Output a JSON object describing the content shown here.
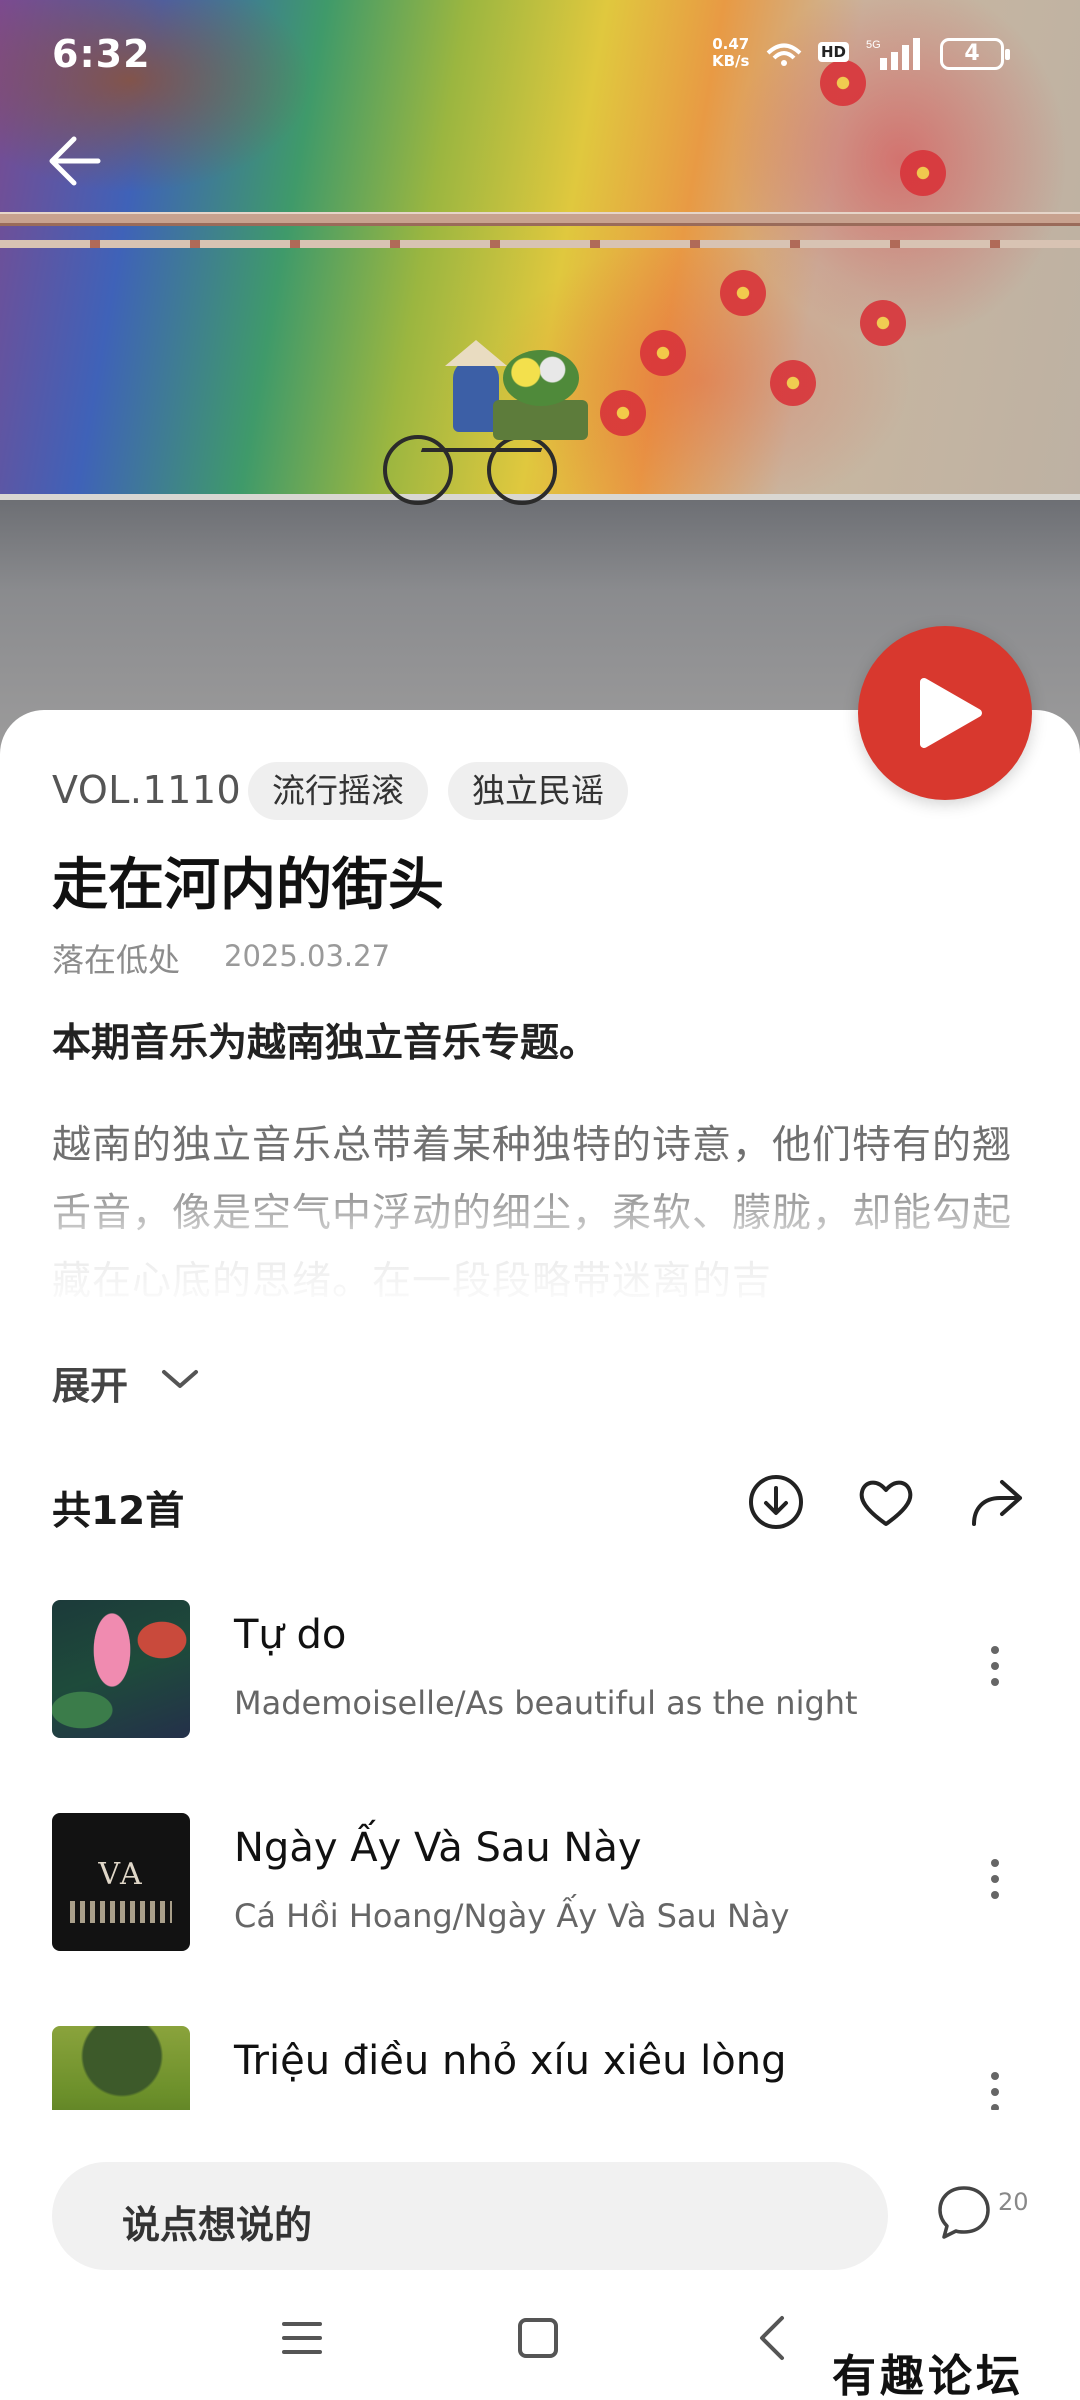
{
  "status_bar": {
    "time": "6:32",
    "net_speed_value": "0.47",
    "net_speed_unit": "KB/s",
    "hd": "HD",
    "network": "5G",
    "battery": "4"
  },
  "header": {
    "back_icon": "arrow-left-icon"
  },
  "playlist": {
    "vol": "VOL.1110",
    "tags": [
      "流行摇滚",
      "独立民谣"
    ],
    "title": "走在河内的街头",
    "author": "落在低处",
    "date": "2025.03.27",
    "lead": "本期音乐为越南独立音乐专题。",
    "description": "越南的独立音乐总带着某种独特的诗意，他们特有的翘舌音，像是空气中浮动的细尘，柔软、朦胧，却能勾起藏在心底的思绪。在一段段略带迷离的吉",
    "expand_label": "展开",
    "play_icon": "play-icon",
    "accent_color": "#d8382e"
  },
  "songs_header": {
    "count_label": "共12首",
    "actions": [
      "download-icon",
      "heart-icon",
      "share-icon"
    ]
  },
  "songs": [
    {
      "title": "Tự do",
      "subtitle": "Mademoiselle/As beautiful as the night"
    },
    {
      "title": "Ngày Ấy Và Sau Này",
      "subtitle": "Cá Hồi Hoang/Ngày Ấy Và Sau Này",
      "cover_text": "VA"
    },
    {
      "title": "Triệu điều nhỏ xíu xiêu lòng",
      "subtitle": ""
    }
  ],
  "comment_bar": {
    "placeholder": "说点想说的",
    "comment_count": "20"
  },
  "nav_bar": {
    "icons": [
      "menu-icon",
      "home-square-icon",
      "back-chevron-icon"
    ]
  },
  "watermark": "有趣论坛"
}
